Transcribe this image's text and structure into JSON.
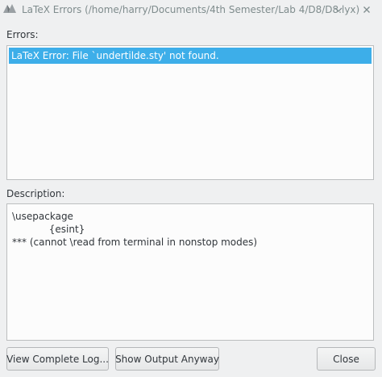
{
  "window": {
    "title": "LaTeX Errors (/home/harry/Documents/4th Semester/Lab 4/D8/D8.lyx)"
  },
  "errors": {
    "label": "Errors:",
    "items": [
      {
        "text": "LaTeX Error: File `undertilde.sty' not found."
      }
    ]
  },
  "description": {
    "label": "Description:",
    "lines": [
      "\\usepackage",
      "            {esint}",
      "*** (cannot \\read from terminal in nonstop modes)"
    ]
  },
  "buttons": {
    "view_log": "View Complete Log...",
    "show_output": "Show Output Anyway",
    "close": "Close"
  },
  "icons": {
    "app": "lyx-app-icon",
    "minimize": "chevron-down-icon",
    "close": "close-icon"
  },
  "colors": {
    "selection": "#3daee9",
    "window_bg": "#eff0f1"
  }
}
